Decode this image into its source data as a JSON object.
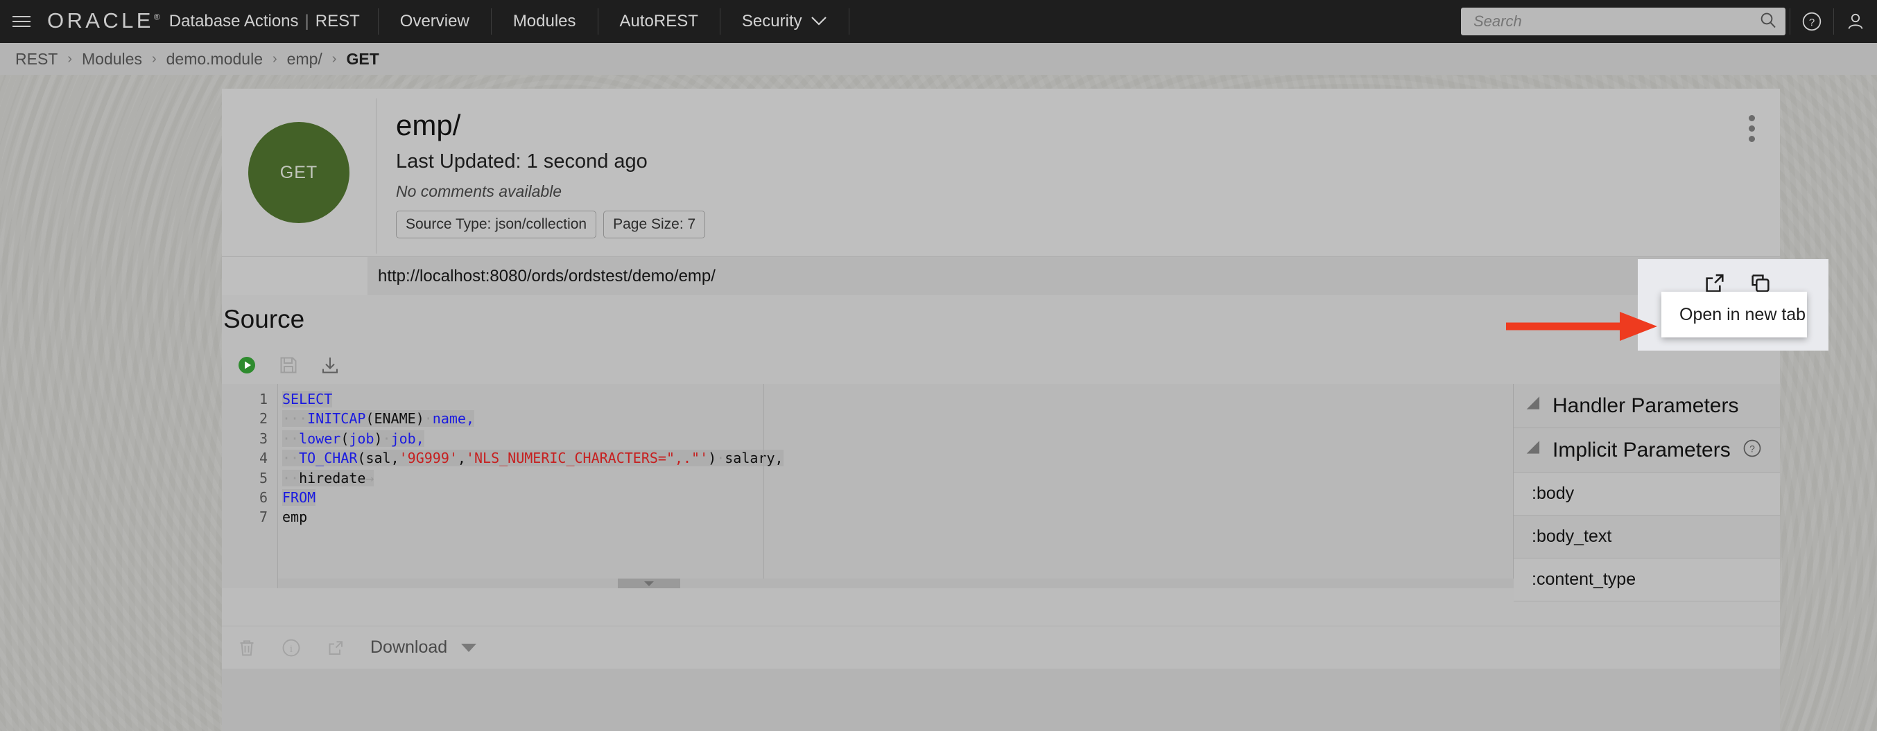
{
  "header": {
    "menu_icon": "hamburger-icon",
    "brand_logo": "ORACLE",
    "brand_registered": "®",
    "brand_text": "Database Actions",
    "brand_separator": "|",
    "brand_section": "REST",
    "nav_tabs": [
      {
        "label": "Overview",
        "active": false
      },
      {
        "label": "Modules",
        "active": false
      },
      {
        "label": "AutoREST",
        "active": false
      },
      {
        "label": "Security",
        "active": false,
        "has_chevron": true
      }
    ],
    "search": {
      "placeholder": "Search",
      "value": "",
      "icon": "search-icon"
    },
    "help_icon": "help-circle-icon",
    "user_icon": "user-avatar-icon"
  },
  "breadcrumb": {
    "items": [
      "REST",
      "Modules",
      "demo.module",
      "emp/",
      "GET"
    ],
    "separator": "›"
  },
  "endpoint": {
    "method": "GET",
    "title": "emp/",
    "last_updated": "Last Updated: 1 second ago",
    "comments": "No comments available",
    "chips": [
      "Source Type: json/collection",
      "Page Size: 7"
    ],
    "url": "http://localhost:8080/ords/ordstest/demo/emp/",
    "kebab_icon": "more-vertical-icon",
    "method_color": "#436127"
  },
  "source": {
    "section_title": "Source",
    "toolbar": [
      {
        "name": "run-button",
        "icon": "play-circle-icon",
        "disabled": false
      },
      {
        "name": "save-button",
        "icon": "save-disk-icon",
        "disabled": true
      },
      {
        "name": "download-button",
        "icon": "download-tray-icon",
        "disabled": false
      }
    ],
    "code_lines": [
      {
        "num": "1",
        "tokens": [
          {
            "t": "SELECT",
            "c": "kw",
            "sel": true
          }
        ]
      },
      {
        "num": "2",
        "tokens": [
          {
            "t": "···",
            "c": "ws",
            "sel": true
          },
          {
            "t": "INITCAP",
            "c": "fn",
            "sel": true
          },
          {
            "t": "(",
            "c": "pl",
            "sel": true
          },
          {
            "t": "ENAME",
            "c": "pl",
            "sel": true
          },
          {
            "t": ")",
            "c": "pl",
            "sel": true
          },
          {
            "t": "·",
            "c": "ws",
            "sel": true
          },
          {
            "t": "name",
            "c": "fn",
            "sel": true
          },
          {
            "t": ",",
            "c": "fn",
            "sel": true
          }
        ]
      },
      {
        "num": "3",
        "tokens": [
          {
            "t": "··",
            "c": "ws",
            "sel": true
          },
          {
            "t": "lower",
            "c": "fn",
            "sel": true
          },
          {
            "t": "(",
            "c": "pl",
            "sel": true
          },
          {
            "t": "job",
            "c": "fn",
            "sel": true
          },
          {
            "t": ")",
            "c": "pl",
            "sel": true
          },
          {
            "t": "·",
            "c": "ws",
            "sel": true
          },
          {
            "t": "job",
            "c": "fn",
            "sel": true
          },
          {
            "t": ",",
            "c": "fn",
            "sel": true
          }
        ]
      },
      {
        "num": "4",
        "tokens": [
          {
            "t": "··",
            "c": "ws",
            "sel": true
          },
          {
            "t": "TO_CHAR",
            "c": "fn",
            "sel": true
          },
          {
            "t": "(",
            "c": "pl",
            "sel": true
          },
          {
            "t": "sal",
            "c": "pl",
            "sel": true
          },
          {
            "t": ",",
            "c": "pl",
            "sel": true
          },
          {
            "t": "'9G999'",
            "c": "str",
            "sel": true
          },
          {
            "t": ",",
            "c": "pl",
            "sel": true
          },
          {
            "t": "'NLS_NUMERIC_CHARACTERS=\",.\"'",
            "c": "str",
            "sel": true
          },
          {
            "t": ")",
            "c": "pl",
            "sel": true
          },
          {
            "t": "·",
            "c": "ws",
            "sel": true
          },
          {
            "t": "salary",
            "c": "pl",
            "sel": true
          },
          {
            "t": ",",
            "c": "pl",
            "sel": true
          }
        ]
      },
      {
        "num": "5",
        "tokens": [
          {
            "t": "··",
            "c": "ws",
            "sel": true
          },
          {
            "t": "hiredate",
            "c": "pl",
            "sel": true
          },
          {
            "t": "→",
            "c": "ws",
            "sel": true
          }
        ]
      },
      {
        "num": "6",
        "tokens": [
          {
            "t": "FROM",
            "c": "kw",
            "sel": true
          }
        ]
      },
      {
        "num": "7",
        "tokens": [
          {
            "t": "emp",
            "c": "pl",
            "sel": false
          }
        ]
      }
    ]
  },
  "params_panel": {
    "sections": [
      {
        "name": "handler-parameters",
        "label": "Handler Parameters",
        "expanded": true,
        "help": false
      },
      {
        "name": "implicit-parameters",
        "label": "Implicit Parameters",
        "expanded": true,
        "help": true
      }
    ],
    "implicit_items": [
      ":body",
      ":body_text",
      ":content_type"
    ]
  },
  "bottom_toolbar": {
    "icons": [
      {
        "name": "delete-button",
        "icon": "trash-icon"
      },
      {
        "name": "info-button",
        "icon": "info-circle-icon"
      },
      {
        "name": "open-external-button",
        "icon": "external-link-icon"
      }
    ],
    "download_label": "Download",
    "download_caret": "caret-down-icon"
  },
  "popup": {
    "open_external_icon": "external-link-icon",
    "copy_icon": "copy-icon",
    "menu_item": "Open in new tab"
  },
  "annotation": {
    "arrow_color": "#ee3b1f",
    "arrow_direction": "right"
  }
}
